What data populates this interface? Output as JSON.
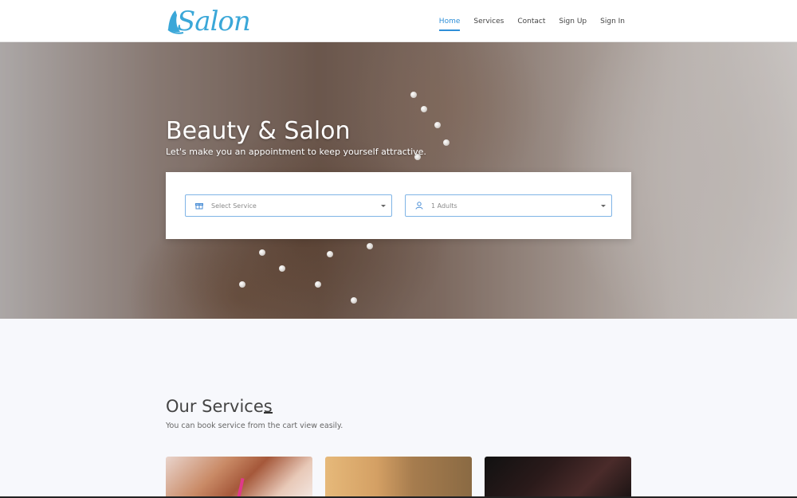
{
  "header": {
    "logo_text": "Salon",
    "nav": [
      {
        "label": "Home",
        "active": true
      },
      {
        "label": "Services",
        "active": false
      },
      {
        "label": "Contact",
        "active": false
      },
      {
        "label": "Sign Up",
        "active": false
      },
      {
        "label": "Sign In",
        "active": false
      }
    ]
  },
  "hero": {
    "title": "Beauty & Salon",
    "subtitle": "Let's make you an appointment to keep yourself attractive.",
    "service_select": {
      "icon": "gift-icon",
      "value": "Select Service"
    },
    "adults_select": {
      "icon": "user-icon",
      "value": "1 Adults"
    }
  },
  "services": {
    "title": "Our Services",
    "subtitle": "You can book service from the cart view easily."
  },
  "colors": {
    "accent": "#2f8fd8",
    "logo": "#3aa7d8",
    "select_border": "#7fb4e6"
  }
}
